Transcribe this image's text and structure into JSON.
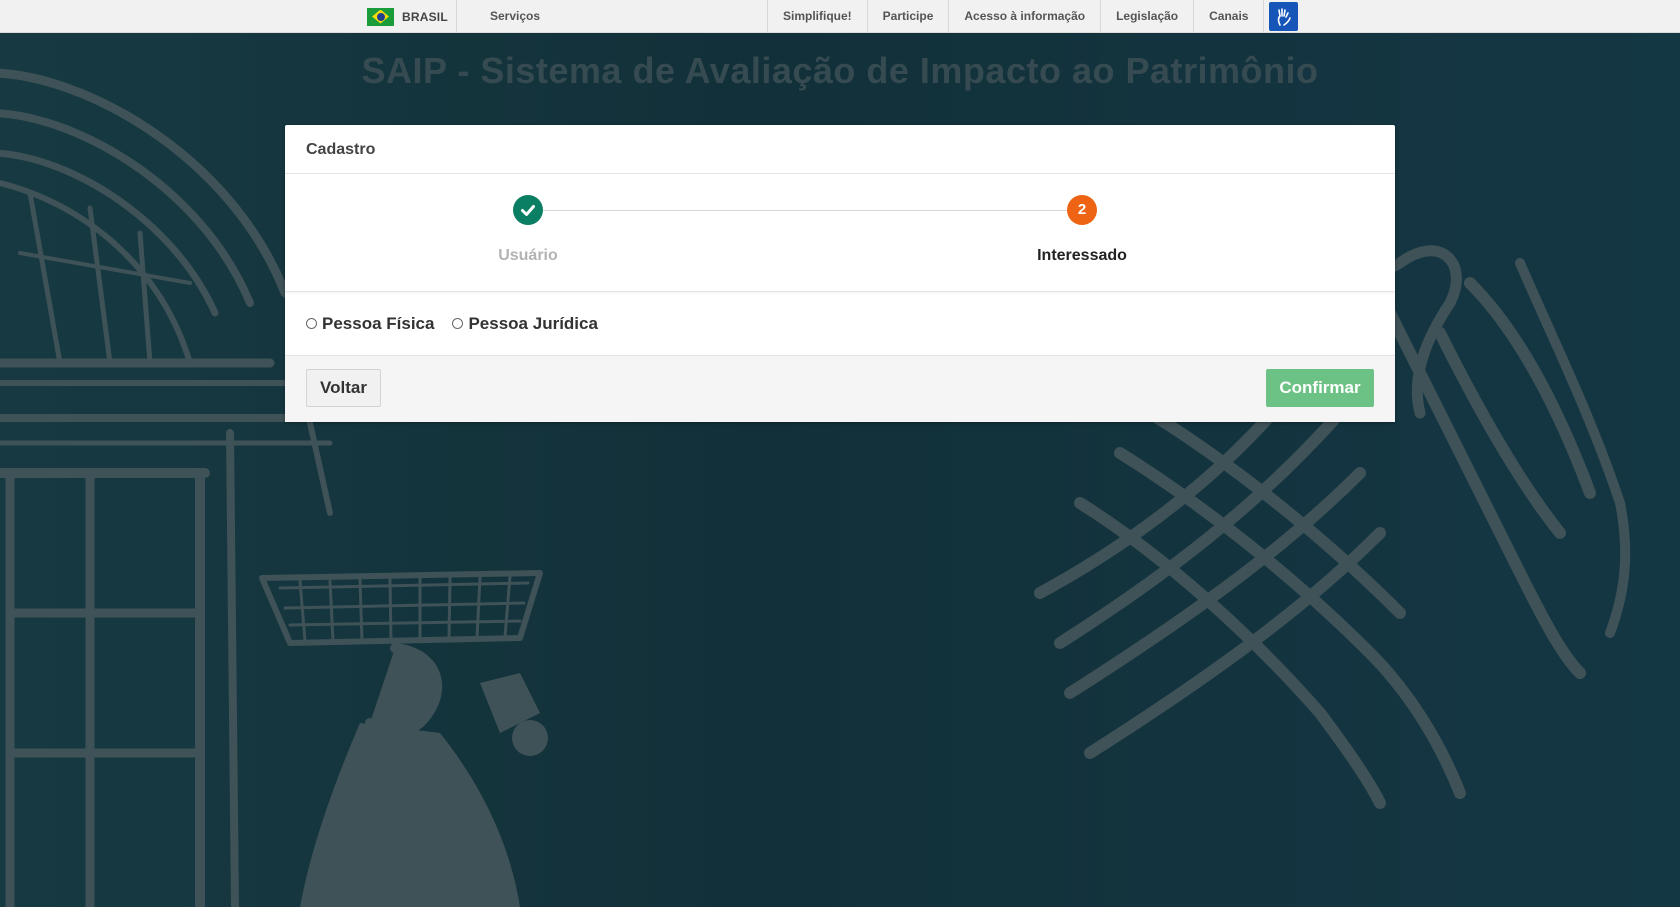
{
  "govbar": {
    "country": "BRASIL",
    "services": "Serviços",
    "links": [
      "Simplifique!",
      "Participe",
      "Acesso à informação",
      "Legislação",
      "Canais"
    ],
    "accessibility_icon": "libras-hands-icon"
  },
  "page": {
    "title": "SAIP - Sistema de Avaliação de Impacto ao Patrimônio"
  },
  "panel": {
    "header": "Cadastro",
    "steps": [
      {
        "label": "Usuário",
        "status": "done",
        "icon": "check-icon"
      },
      {
        "label": "Interessado",
        "status": "active",
        "number": "2"
      }
    ],
    "options": [
      {
        "label": "Pessoa Física",
        "checked": false
      },
      {
        "label": "Pessoa Jurídica",
        "checked": false
      }
    ],
    "back_label": "Voltar",
    "confirm_label": "Confirmar"
  },
  "colors": {
    "step_done": "#0b7f63",
    "step_active": "#ef6314",
    "confirm": "#6cc284",
    "background": "#14343f"
  }
}
